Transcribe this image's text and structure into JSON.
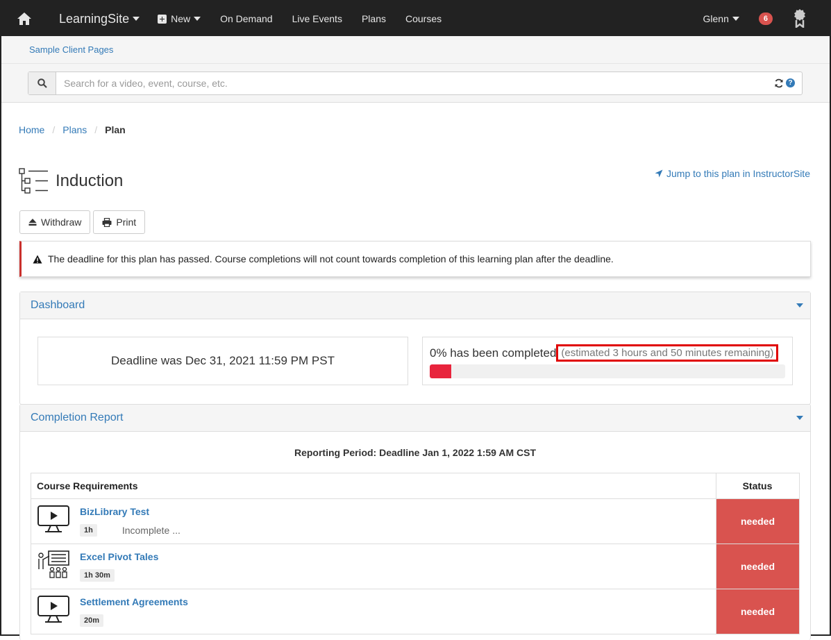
{
  "nav": {
    "brand": "LearningSite",
    "new_label": "New",
    "items": [
      "On Demand",
      "Live Events",
      "Plans",
      "Courses"
    ],
    "user": "Glenn",
    "notifications": "6"
  },
  "subheader": {
    "link": "Sample Client Pages"
  },
  "search": {
    "placeholder": "Search for a video, event, course, etc."
  },
  "breadcrumb": {
    "home": "Home",
    "plans": "Plans",
    "current": "Plan"
  },
  "page": {
    "title": "Induction",
    "jump_link": "Jump to this plan in InstructorSite"
  },
  "buttons": {
    "withdraw": "Withdraw",
    "print": "Print"
  },
  "alert": {
    "text": "The deadline for this plan has passed. Course completions will not count towards completion of this learning plan after the deadline."
  },
  "dashboard": {
    "title": "Dashboard",
    "deadline_text": "Deadline was Dec 31, 2021 11:59 PM PST",
    "completed_text": "0% has been completed",
    "estimate_text": "(estimated 3 hours and 50 minutes remaining)",
    "progress_percent": 6,
    "progress_color": "#e8243c"
  },
  "report": {
    "title": "Completion Report",
    "reporting_period": "Reporting Period: Deadline Jan 1, 2022 1:59 AM CST",
    "col_requirements": "Course Requirements",
    "col_status": "Status",
    "rows": [
      {
        "name": "BizLibrary Test",
        "duration": "1h",
        "note": "Incomplete ...",
        "status": "needed",
        "icon": "video-monitor-icon"
      },
      {
        "name": "Excel Pivot Tales",
        "duration": "1h 30m",
        "note": "",
        "status": "needed",
        "icon": "classroom-presentation-icon"
      },
      {
        "name": "Settlement Agreements",
        "duration": "20m",
        "note": "",
        "status": "needed",
        "icon": "video-monitor-icon"
      }
    ]
  },
  "colors": {
    "link": "#337ab7",
    "status_needed": "#d9534f",
    "alert_border": "#c9302c",
    "nav_bg": "#222222"
  }
}
